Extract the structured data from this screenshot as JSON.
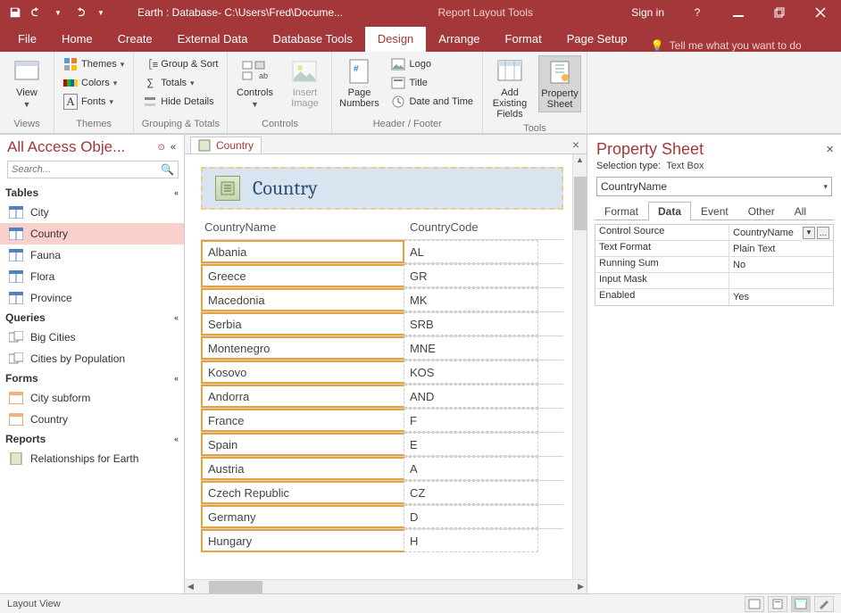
{
  "titlebar": {
    "doc_title": "Earth : Database- C:\\Users\\Fred\\Docume...",
    "context_title": "Report Layout Tools",
    "signin": "Sign in"
  },
  "tabs": {
    "file": "File",
    "home": "Home",
    "create": "Create",
    "external": "External Data",
    "dbtools": "Database Tools",
    "design": "Design",
    "arrange": "Arrange",
    "format": "Format",
    "pagesetup": "Page Setup",
    "tellme": "Tell me what you want to do"
  },
  "ribbon": {
    "views": {
      "view": "View",
      "group": "Views"
    },
    "themes": {
      "themes": "Themes",
      "colors": "Colors",
      "fonts": "Fonts",
      "group": "Themes"
    },
    "grouping": {
      "gs": "Group & Sort",
      "totals": "Totals",
      "hide": "Hide Details",
      "group": "Grouping & Totals"
    },
    "controls": {
      "controls": "Controls",
      "insertimg": "Insert\nImage",
      "group": "Controls"
    },
    "hf": {
      "pagenum": "Page\nNumbers",
      "logo": "Logo",
      "title": "Title",
      "datetime": "Date and Time",
      "group": "Header / Footer"
    },
    "tools": {
      "addfields": "Add Existing\nFields",
      "propsheet": "Property\nSheet",
      "group": "Tools"
    }
  },
  "nav": {
    "title": "All Access Obje...",
    "search_placeholder": "Search...",
    "groups": {
      "tables": {
        "label": "Tables",
        "items": [
          "City",
          "Country",
          "Fauna",
          "Flora",
          "Province"
        ],
        "selected": 1
      },
      "queries": {
        "label": "Queries",
        "items": [
          "Big Cities",
          "Cities by Population"
        ]
      },
      "forms": {
        "label": "Forms",
        "items": [
          "City subform",
          "Country"
        ]
      },
      "reports": {
        "label": "Reports",
        "items": [
          "Relationships for Earth"
        ]
      }
    }
  },
  "doc": {
    "tab_label": "Country",
    "report_title": "Country",
    "columns": {
      "name": "CountryName",
      "code": "CountryCode"
    },
    "rows": [
      {
        "name": "Albania",
        "code": "AL"
      },
      {
        "name": "Greece",
        "code": "GR"
      },
      {
        "name": "Macedonia",
        "code": "MK"
      },
      {
        "name": "Serbia",
        "code": "SRB"
      },
      {
        "name": "Montenegro",
        "code": "MNE"
      },
      {
        "name": "Kosovo",
        "code": "KOS"
      },
      {
        "name": "Andorra",
        "code": "AND"
      },
      {
        "name": "France",
        "code": "F"
      },
      {
        "name": "Spain",
        "code": "E"
      },
      {
        "name": "Austria",
        "code": "A"
      },
      {
        "name": "Czech Republic",
        "code": "CZ"
      },
      {
        "name": "Germany",
        "code": "D"
      },
      {
        "name": "Hungary",
        "code": "H"
      }
    ]
  },
  "props": {
    "title": "Property Sheet",
    "seltype_label": "Selection type:",
    "seltype_value": "Text Box",
    "object": "CountryName",
    "tabs": {
      "format": "Format",
      "data": "Data",
      "event": "Event",
      "other": "Other",
      "all": "All"
    },
    "rows": [
      {
        "k": "Control Source",
        "v": "CountryName",
        "dd": true,
        "builder": true
      },
      {
        "k": "Text Format",
        "v": "Plain Text"
      },
      {
        "k": "Running Sum",
        "v": "No"
      },
      {
        "k": "Input Mask",
        "v": ""
      },
      {
        "k": "Enabled",
        "v": "Yes"
      }
    ]
  },
  "status": {
    "left": "Layout View"
  }
}
